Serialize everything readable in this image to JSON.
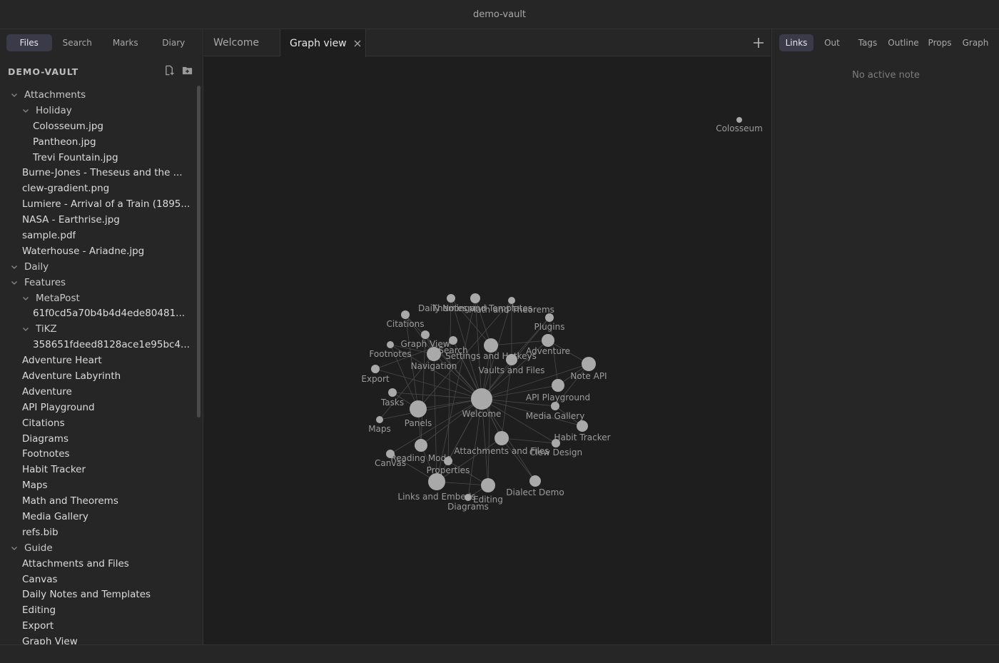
{
  "window": {
    "title": "demo-vault"
  },
  "left_tabs": [
    "Files",
    "Search",
    "Marks",
    "Diary"
  ],
  "vault": {
    "name": "DEMO-VAULT",
    "icons": [
      "new-note-icon",
      "new-folder-icon"
    ]
  },
  "tree": [
    {
      "label": "Attachments",
      "depth": 0,
      "folder": true
    },
    {
      "label": "Holiday",
      "depth": 1,
      "folder": true
    },
    {
      "label": "Colosseum.jpg",
      "depth": 2
    },
    {
      "label": "Pantheon.jpg",
      "depth": 2
    },
    {
      "label": "Trevi Fountain.jpg",
      "depth": 2
    },
    {
      "label": "Burne-Jones - Theseus and the ...",
      "depth": 1
    },
    {
      "label": "clew-gradient.png",
      "depth": 1
    },
    {
      "label": "Lumiere - Arrival of a Train (1895...",
      "depth": 1
    },
    {
      "label": "NASA - Earthrise.jpg",
      "depth": 1
    },
    {
      "label": "sample.pdf",
      "depth": 1
    },
    {
      "label": "Waterhouse - Ariadne.jpg",
      "depth": 1
    },
    {
      "label": "Daily",
      "depth": 0,
      "folder": true
    },
    {
      "label": "Features",
      "depth": 0,
      "folder": true
    },
    {
      "label": "MetaPost",
      "depth": 1,
      "folder": true
    },
    {
      "label": "61f0cd5a70b4b4d4ede80481...",
      "depth": 2
    },
    {
      "label": "TiKZ",
      "depth": 1,
      "folder": true
    },
    {
      "label": "358651fdeed8128ace1e95bc4...",
      "depth": 2
    },
    {
      "label": "Adventure Heart",
      "depth": 1
    },
    {
      "label": "Adventure Labyrinth",
      "depth": 1
    },
    {
      "label": "Adventure",
      "depth": 1
    },
    {
      "label": "API Playground",
      "depth": 1
    },
    {
      "label": "Citations",
      "depth": 1
    },
    {
      "label": "Diagrams",
      "depth": 1
    },
    {
      "label": "Footnotes",
      "depth": 1
    },
    {
      "label": "Habit Tracker",
      "depth": 1
    },
    {
      "label": "Maps",
      "depth": 1
    },
    {
      "label": "Math and Theorems",
      "depth": 1
    },
    {
      "label": "Media Gallery",
      "depth": 1
    },
    {
      "label": "refs.bib",
      "depth": 1
    },
    {
      "label": "Guide",
      "depth": 0,
      "folder": true
    },
    {
      "label": "Attachments and Files",
      "depth": 1
    },
    {
      "label": "Canvas",
      "depth": 1
    },
    {
      "label": "Daily Notes and Templates",
      "depth": 1
    },
    {
      "label": "Editing",
      "depth": 1
    },
    {
      "label": "Export",
      "depth": 1
    },
    {
      "label": "Graph View",
      "depth": 1
    }
  ],
  "main_tabs": [
    {
      "label": "Welcome",
      "active": false
    },
    {
      "label": "Graph view",
      "active": true
    }
  ],
  "graph": {
    "nodes": [
      {
        "id": "welcome",
        "label": "Welcome"
      },
      {
        "id": "colosseum",
        "label": "Colosseum"
      },
      {
        "id": "theming",
        "label": "Theming"
      },
      {
        "id": "dailynotes",
        "label": "Daily Notes and Templates"
      },
      {
        "id": "math",
        "label": "Math and Theorems"
      },
      {
        "id": "citations",
        "label": "Citations"
      },
      {
        "id": "plugins",
        "label": "Plugins"
      },
      {
        "id": "graphview",
        "label": "Graph View"
      },
      {
        "id": "search",
        "label": "Search"
      },
      {
        "id": "adventure",
        "label": "Adventure"
      },
      {
        "id": "footnotes",
        "label": "Footnotes"
      },
      {
        "id": "settings",
        "label": "Settings and Hotkeys"
      },
      {
        "id": "navigation",
        "label": "Navigation"
      },
      {
        "id": "noteapi",
        "label": "Note API"
      },
      {
        "id": "vaults",
        "label": "Vaults and Files"
      },
      {
        "id": "export",
        "label": "Export"
      },
      {
        "id": "apiplay",
        "label": "API Playground"
      },
      {
        "id": "tasks",
        "label": "Tasks"
      },
      {
        "id": "mediagallery",
        "label": "Media Gallery"
      },
      {
        "id": "panels",
        "label": "Panels"
      },
      {
        "id": "maps",
        "label": "Maps"
      },
      {
        "id": "habit",
        "label": "Habit Tracker"
      },
      {
        "id": "attachments",
        "label": "Attachments and Files"
      },
      {
        "id": "clew",
        "label": "Clew Design"
      },
      {
        "id": "reading",
        "label": "Reading Mode"
      },
      {
        "id": "canvas",
        "label": "Canvas"
      },
      {
        "id": "properties",
        "label": "Properties"
      },
      {
        "id": "dialect",
        "label": "Dialect Demo"
      },
      {
        "id": "links",
        "label": "Links and Embeds"
      },
      {
        "id": "editing",
        "label": "Editing"
      },
      {
        "id": "diagrams",
        "label": "Diagrams"
      }
    ]
  },
  "right_tabs": [
    "Links",
    "Out",
    "Tags",
    "Outline",
    "Props",
    "Graph"
  ],
  "right_panel": {
    "empty_text": "No active note"
  }
}
